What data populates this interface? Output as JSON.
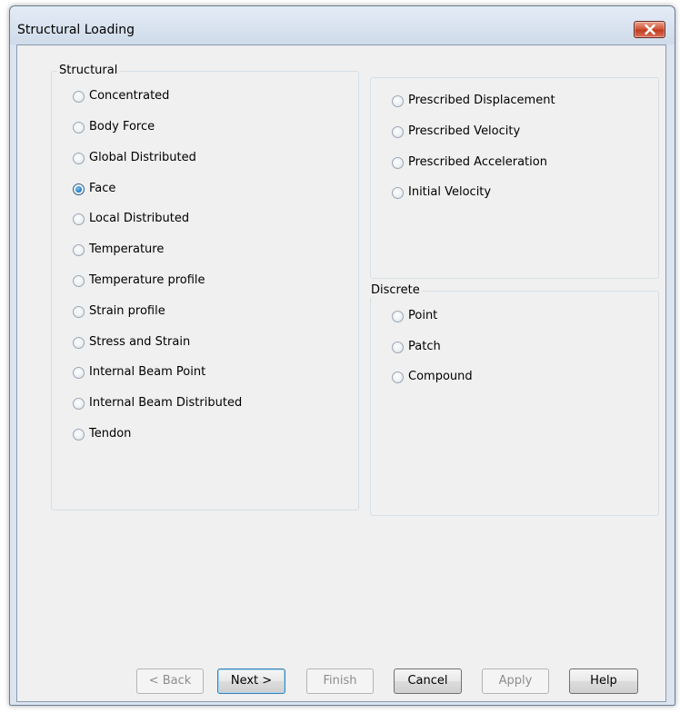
{
  "window": {
    "title": "Structural Loading",
    "close_icon": "close-x-icon"
  },
  "structural_group": {
    "legend": "Structural",
    "options": [
      {
        "label": "Concentrated",
        "checked": false
      },
      {
        "label": "Body Force",
        "checked": false
      },
      {
        "label": "Global Distributed",
        "checked": false
      },
      {
        "label": "Face",
        "checked": true
      },
      {
        "label": "Local Distributed",
        "checked": false
      },
      {
        "label": "Temperature",
        "checked": false
      },
      {
        "label": "Temperature profile",
        "checked": false
      },
      {
        "label": "Strain profile",
        "checked": false
      },
      {
        "label": "Stress and Strain",
        "checked": false
      },
      {
        "label": "Internal Beam Point",
        "checked": false
      },
      {
        "label": "Internal Beam Distributed",
        "checked": false
      },
      {
        "label": "Tendon",
        "checked": false
      }
    ]
  },
  "prescribed_group": {
    "options": [
      {
        "label": "Prescribed Displacement",
        "checked": false
      },
      {
        "label": "Prescribed Velocity",
        "checked": false
      },
      {
        "label": "Prescribed Acceleration",
        "checked": false
      },
      {
        "label": "Initial Velocity",
        "checked": false
      }
    ]
  },
  "discrete_group": {
    "legend": "Discrete",
    "options": [
      {
        "label": "Point",
        "checked": false
      },
      {
        "label": "Patch",
        "checked": false
      },
      {
        "label": "Compound",
        "checked": false
      }
    ]
  },
  "buttons": {
    "back": "< Back",
    "next": "Next >",
    "finish": "Finish",
    "cancel": "Cancel",
    "apply": "Apply",
    "help": "Help"
  },
  "colors": {
    "selected_radio": "#2c87c9",
    "close_button": "#c23d20"
  }
}
